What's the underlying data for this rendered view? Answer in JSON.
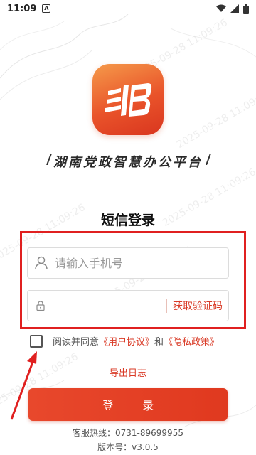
{
  "status_bar": {
    "time": "11:09",
    "badge": "A"
  },
  "app": {
    "name": "湖南党政智慧办公平台"
  },
  "login": {
    "title": "短信登录",
    "phone_placeholder": "请输入手机号",
    "code_placeholder": "",
    "get_code_label": "获取验证码",
    "agree_prefix": "阅读并同意",
    "user_agreement": "《用户协议》",
    "and": "和",
    "privacy_policy": "《隐私政策》",
    "export_log": "导出日志",
    "login_button": "登 录",
    "hotline": "客服热线：0731-89699955",
    "version": "版本号：v3.0.5"
  },
  "watermark_text": "2025-09-28 11:09:26",
  "colors": {
    "accent": "#d93a26",
    "highlight": "#e02020"
  }
}
